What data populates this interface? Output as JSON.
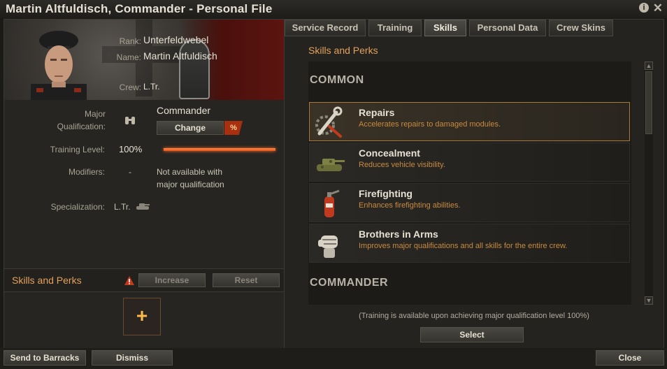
{
  "window": {
    "title": "Martin Altfuldisch, Commander - Personal File"
  },
  "profile": {
    "rank_label": "Rank:",
    "rank": "Unterfeldwebel",
    "name_label": "Name:",
    "name": "Martin Altfuldisch",
    "crew_label": "Crew:",
    "crew": "L.Tr."
  },
  "details": {
    "major_qual_label_1": "Major",
    "major_qual_label_2": "Qualification:",
    "major_qual_value": "Commander",
    "change_label": "Change",
    "percent_badge": "%",
    "training_label": "Training Level:",
    "training_value": "100%",
    "training_fraction": 1.0,
    "modifiers_label": "Modifiers:",
    "modifiers_value": "-",
    "modifiers_note_1": "Not available with",
    "modifiers_note_2": "major qualification",
    "specialization_label": "Specialization:",
    "specialization_value": "L.Tr."
  },
  "skills_panel": {
    "title": "Skills and Perks",
    "increase_label": "Increase",
    "reset_label": "Reset",
    "add_slot": "+"
  },
  "tabs": [
    {
      "label": "Service Record"
    },
    {
      "label": "Training"
    },
    {
      "label": "Skills",
      "active": true
    },
    {
      "label": "Personal Data"
    },
    {
      "label": "Crew Skins"
    }
  ],
  "skills": {
    "title": "Skills and Perks",
    "groups": {
      "common": "COMMON",
      "commander": "COMMANDER"
    },
    "items": [
      {
        "name": "Repairs",
        "desc": "Accelerates repairs to damaged modules.",
        "icon": "wrench-icon",
        "selected": true
      },
      {
        "name": "Concealment",
        "desc": "Reduces vehicle visibility.",
        "icon": "camouflaged-tank-icon"
      },
      {
        "name": "Firefighting",
        "desc": "Enhances firefighting abilities.",
        "icon": "fire-extinguisher-icon"
      },
      {
        "name": "Brothers in Arms",
        "desc": "Improves major qualifications and all skills for the entire crew.",
        "icon": "fist-icon"
      }
    ],
    "note": "(Training is available upon achieving major qualification level 100%)",
    "select_label": "Select"
  },
  "footer": {
    "barracks_label": "Send to Barracks",
    "dismiss_label": "Dismiss",
    "close_label": "Close"
  }
}
